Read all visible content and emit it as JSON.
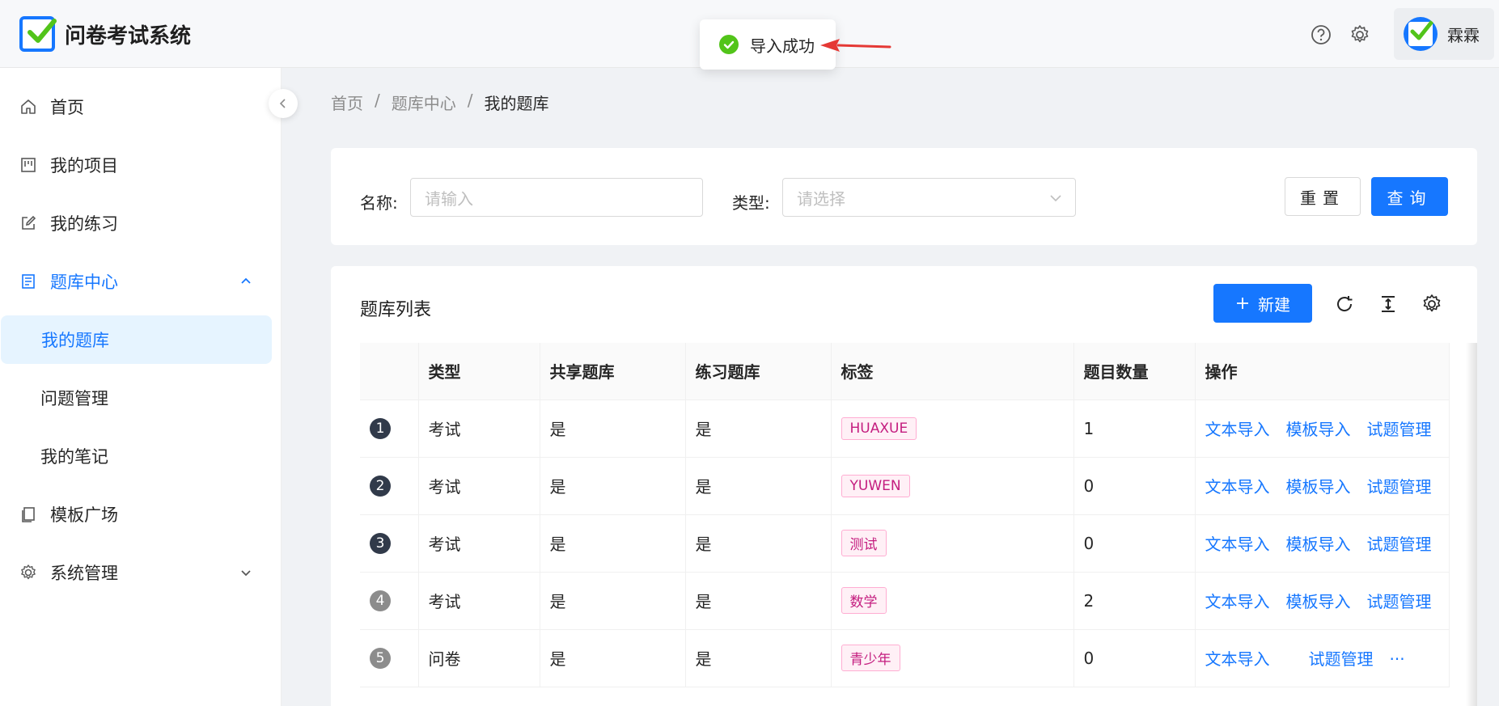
{
  "app": {
    "title": "问卷考试系统",
    "brand_color": "#1677ff"
  },
  "header": {
    "help_icon": "help-circle-icon",
    "settings_icon": "gear-icon",
    "user_name": "霖霖"
  },
  "toast": {
    "message": "导入成功",
    "type": "success"
  },
  "sidebar": {
    "items": [
      {
        "label": "首页",
        "icon": "home-icon"
      },
      {
        "label": "我的项目",
        "icon": "project-icon"
      },
      {
        "label": "我的练习",
        "icon": "edit-icon"
      },
      {
        "label": "题库中心",
        "icon": "book-icon",
        "expanded": true
      },
      {
        "label": "模板广场",
        "icon": "template-icon"
      },
      {
        "label": "系统管理",
        "icon": "gear-icon"
      }
    ],
    "sub_items": [
      {
        "label": "我的题库",
        "selected": true
      },
      {
        "label": "问题管理"
      },
      {
        "label": "我的笔记"
      }
    ]
  },
  "breadcrumb": {
    "items": [
      "首页",
      "题库中心",
      "我的题库"
    ],
    "separator": "/"
  },
  "filter": {
    "name_label": "名称:",
    "name_placeholder": "请输入",
    "type_label": "类型:",
    "type_placeholder": "请选择",
    "reset_label": "重置",
    "query_label": "查询"
  },
  "table_card": {
    "title": "题库列表",
    "new_label": "新建",
    "columns": [
      "",
      "类型",
      "共享题库",
      "练习题库",
      "标签",
      "题目数量",
      "操作"
    ],
    "rows": [
      {
        "index": "1",
        "type": "考试",
        "shared": "是",
        "practice": "是",
        "tag": "HUAXUE",
        "count": "1",
        "ops": [
          "文本导入",
          "模板导入",
          "试题管理"
        ]
      },
      {
        "index": "2",
        "type": "考试",
        "shared": "是",
        "practice": "是",
        "tag": "YUWEN",
        "count": "0",
        "ops": [
          "文本导入",
          "模板导入",
          "试题管理"
        ]
      },
      {
        "index": "3",
        "type": "考试",
        "shared": "是",
        "practice": "是",
        "tag": "测试",
        "count": "0",
        "ops": [
          "文本导入",
          "模板导入",
          "试题管理"
        ]
      },
      {
        "index": "4",
        "type": "考试",
        "shared": "是",
        "practice": "是",
        "tag": "数学",
        "count": "2",
        "ops": [
          "文本导入",
          "模板导入",
          "试题管理"
        ]
      },
      {
        "index": "5",
        "type": "问卷",
        "shared": "是",
        "practice": "是",
        "tag": "青少年",
        "count": "0",
        "ops": [
          "文本导入",
          "试题管理",
          "···"
        ]
      }
    ]
  }
}
